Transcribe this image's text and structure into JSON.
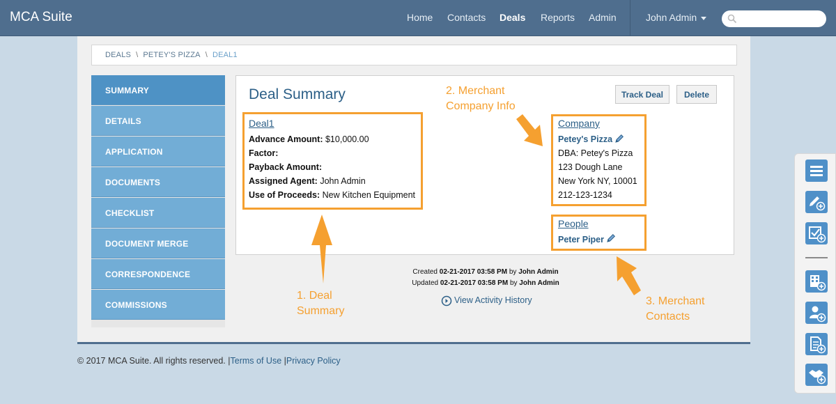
{
  "app": {
    "brand": "MCA Suite"
  },
  "nav": {
    "items": [
      "Home",
      "Contacts",
      "Deals",
      "Reports",
      "Admin"
    ],
    "active": "Deals",
    "user": "John Admin"
  },
  "breadcrumb": [
    "DEALS",
    "PETEY'S PIZZA",
    "DEAL1"
  ],
  "sidebar": {
    "items": [
      "SUMMARY",
      "DETAILS",
      "APPLICATION",
      "DOCUMENTS",
      "CHECKLIST",
      "DOCUMENT MERGE",
      "CORRESPONDENCE",
      "COMMISSIONS"
    ],
    "active": "SUMMARY"
  },
  "summary": {
    "title": "Deal Summary",
    "track_label": "Track Deal",
    "delete_label": "Delete",
    "deal": {
      "name": "Deal1",
      "advance_label": "Advance Amount:",
      "advance_value": "$10,000.00",
      "factor_label": "Factor:",
      "payback_label": "Payback Amount:",
      "agent_label": "Assigned Agent:",
      "agent_value": "John Admin",
      "proceeds_label": "Use of Proceeds:",
      "proceeds_value": "New Kitchen Equipment"
    },
    "company": {
      "heading": "Company",
      "name": "Petey's Pizza",
      "dba": "DBA: Petey's Pizza",
      "street": "123 Dough Lane",
      "city": "New York NY, 10001",
      "phone": "212-123-1234"
    },
    "people": {
      "heading": "People",
      "name": "Peter Piper"
    }
  },
  "meta": {
    "created_label": "Created",
    "created_date": "02-21-2017 03:58 PM",
    "updated_label": "Updated",
    "updated_date": "02-21-2017 03:58 PM",
    "by": "by",
    "by_user": "John Admin",
    "activity_link": "View Activity History"
  },
  "annotations": {
    "a1_line1": "1. Deal",
    "a1_line2": "Summary",
    "a2_line1": "2. Merchant",
    "a2_line2": "Company Info",
    "a3_line1": "3. Merchant",
    "a3_line2": "Contacts"
  },
  "footer": {
    "copyright": "© 2017 MCA Suite. All rights reserved.",
    "sep": "|",
    "terms": "Terms of Use",
    "privacy": "Privacy Policy"
  },
  "toolbar": {
    "icons": [
      "list-icon",
      "edit-add-icon",
      "checklist-add-icon",
      "building-add-icon",
      "person-add-icon",
      "document-add-icon",
      "handshake-add-icon"
    ]
  },
  "colors": {
    "navbar": "#4f6e8e",
    "sidebar_item": "#72add6",
    "sidebar_active": "#4e92c5",
    "annotation": "#f5a030",
    "link": "#2c5f87",
    "tool_button": "#4f90c8"
  }
}
